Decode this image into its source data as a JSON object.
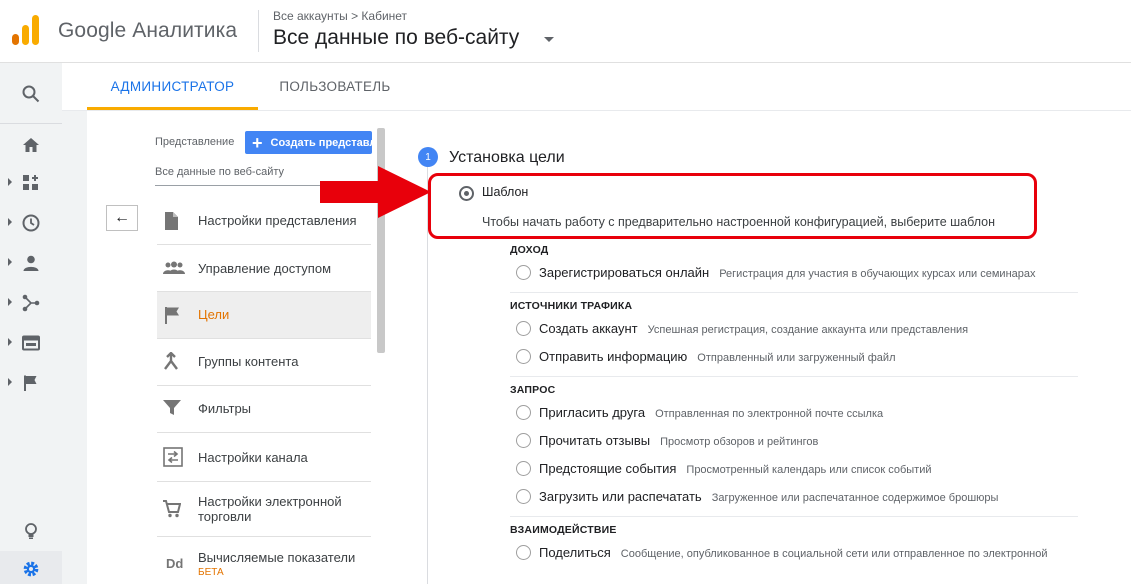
{
  "header": {
    "app_title": "Google Аналитика",
    "breadcrumb": "Все аккаунты > Кабинет",
    "property_title": "Все данные по веб-сайту"
  },
  "tabs": {
    "admin": "АДМИНИСТРАТОР",
    "user": "ПОЛЬЗОВАТЕЛЬ"
  },
  "view_panel": {
    "label": "Представление",
    "create_button": "Создать представление",
    "selected_view": "Все данные по веб-сайту",
    "collapse_icon": "←"
  },
  "menu": {
    "view_settings": "Настройки представления",
    "access_management": "Управление доступом",
    "goals": "Цели",
    "content_groups": "Группы контента",
    "filters": "Фильтры",
    "channel_settings": "Настройки канала",
    "ecommerce_line1": "Настройки электронной",
    "ecommerce_line2": "торговли",
    "calculated_metrics": "Вычисляемые показатели",
    "calculated_badge": "БЕТА",
    "dd_icon": "Dd"
  },
  "goal_setup": {
    "step_number": "1",
    "title": "Установка цели",
    "template_label": "Шаблон",
    "template_desc": "Чтобы начать работу с предварительно настроенной конфигурацией, выберите шаблон",
    "categories": {
      "revenue": {
        "title": "ДОХОД",
        "options": [
          {
            "label": "Зарегистрироваться онлайн",
            "desc": "Регистрация для участия в обучающих курсах или семинарах"
          }
        ]
      },
      "acquisition": {
        "title": "ИСТОЧНИКИ ТРАФИКА",
        "options": [
          {
            "label": "Создать аккаунт",
            "desc": "Успешная регистрация, создание аккаунта или представления"
          },
          {
            "label": "Отправить информацию",
            "desc": "Отправленный или загруженный файл"
          }
        ]
      },
      "inquiry": {
        "title": "ЗАПРОС",
        "options": [
          {
            "label": "Пригласить друга",
            "desc": "Отправленная по электронной почте ссылка"
          },
          {
            "label": "Прочитать отзывы",
            "desc": "Просмотр обзоров и рейтингов"
          },
          {
            "label": "Предстоящие события",
            "desc": "Просмотренный календарь или список событий"
          },
          {
            "label": "Загрузить или распечатать",
            "desc": "Загруженное или распечатанное содержимое брошюры"
          }
        ]
      },
      "engagement": {
        "title": "ВЗАИМОДЕЙСТВИЕ",
        "options": [
          {
            "label": "Поделиться",
            "desc": "Сообщение, опубликованное в социальной сети или отправленное по электронной"
          }
        ]
      }
    }
  },
  "colors": {
    "accent": "#1a73e8",
    "tab_underline": "#f9ab00",
    "highlight": "#e8000b",
    "active_item": "#e37400"
  }
}
